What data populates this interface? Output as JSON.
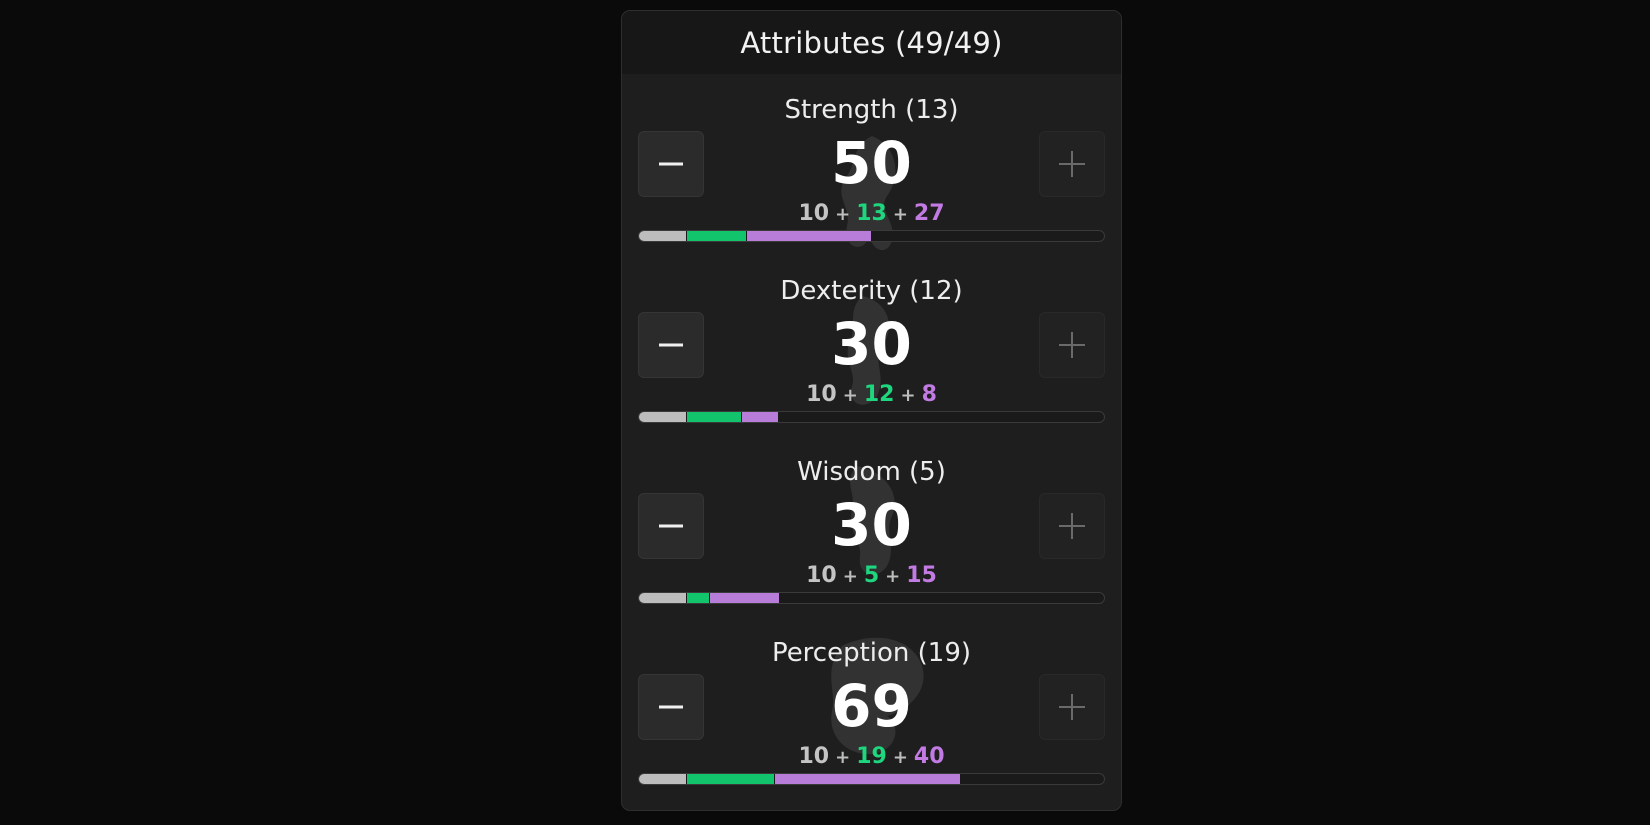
{
  "header": {
    "title": "Attributes (49/49)"
  },
  "bar_max": 100,
  "colors": {
    "base": "#bdbdbd",
    "allocated": "#12c46c",
    "bonus": "#b77dd8",
    "panel": "#1e1e1e"
  },
  "attributes": [
    {
      "label": "Strength (13)",
      "total": "50",
      "base": "10",
      "allocated": "13",
      "bonus": "27",
      "plus_sign": "+",
      "minus_icon": "minus-icon",
      "plus_icon": "plus-icon"
    },
    {
      "label": "Dexterity (12)",
      "total": "30",
      "base": "10",
      "allocated": "12",
      "bonus": "8",
      "plus_sign": "+",
      "minus_icon": "minus-icon",
      "plus_icon": "plus-icon"
    },
    {
      "label": "Wisdom (5)",
      "total": "30",
      "base": "10",
      "allocated": "5",
      "bonus": "15",
      "plus_sign": "+",
      "minus_icon": "minus-icon",
      "plus_icon": "plus-icon"
    },
    {
      "label": "Perception (19)",
      "total": "69",
      "base": "10",
      "allocated": "19",
      "bonus": "40",
      "plus_sign": "+",
      "minus_icon": "minus-icon",
      "plus_icon": "plus-icon"
    }
  ]
}
